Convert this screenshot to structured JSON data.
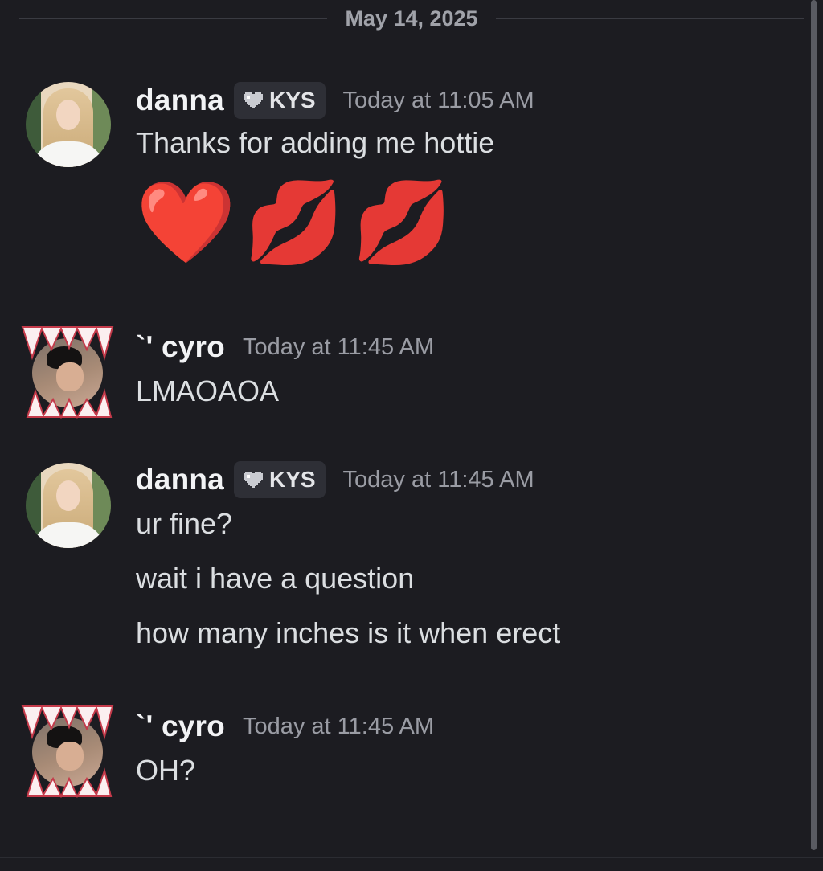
{
  "date_divider": "May 14, 2025",
  "messages": [
    {
      "username": "danna",
      "tag": "KYS",
      "timestamp": "Today at 11:05 AM",
      "lines": [
        "Thanks for adding me hottie"
      ],
      "emojis": [
        "❤️",
        "💋",
        "💋"
      ]
    },
    {
      "username": "`' cyro",
      "timestamp": "Today at 11:45 AM",
      "lines": [
        "LMAOAOA"
      ]
    },
    {
      "username": "danna",
      "tag": "KYS",
      "timestamp": "Today at 11:45 AM",
      "lines": [
        "ur fine?",
        "wait i have a question",
        "how many inches is it when erect"
      ]
    },
    {
      "username": "`' cyro",
      "timestamp": "Today at 11:45 AM",
      "lines": [
        "OH?"
      ]
    }
  ],
  "icons": {
    "tag_icon": "pixel-heart-icon",
    "avatar_frame": "fangs-frame"
  },
  "colors": {
    "background": "#1c1c21",
    "username": "#f2f3f5",
    "timestamp": "#9a9ca4",
    "tag_background": "#2e2f36"
  }
}
